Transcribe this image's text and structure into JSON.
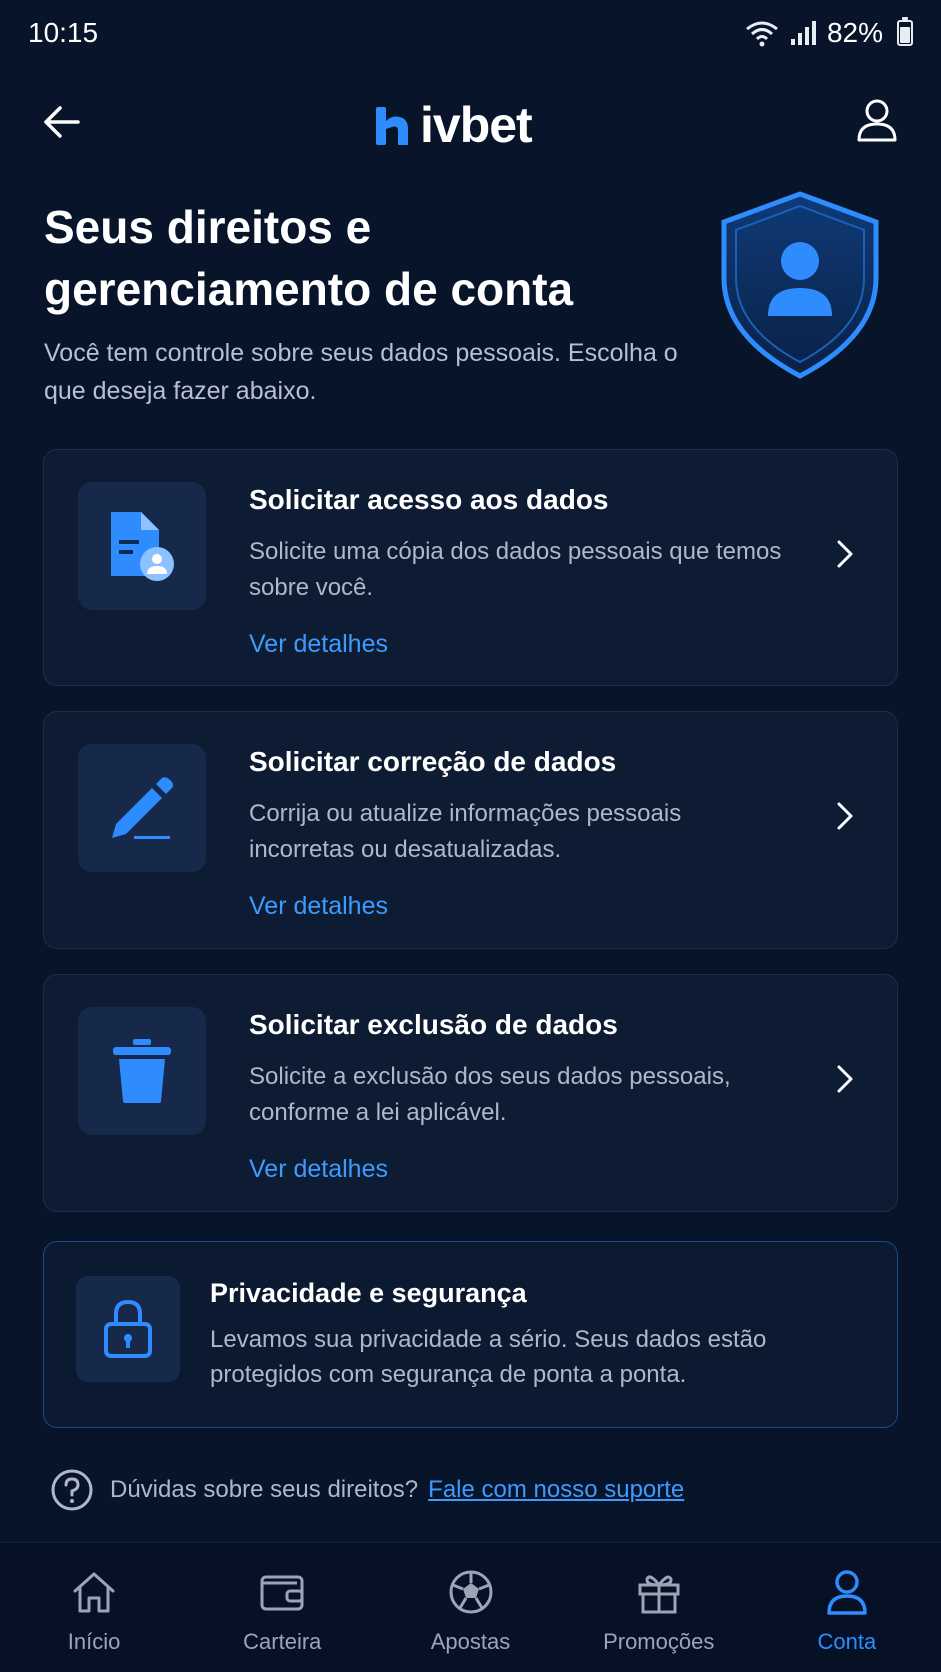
{
  "status_bar": {
    "time": "10:15",
    "battery": "82%",
    "battery_level": 0.82
  },
  "header": {
    "brand": "ivbet"
  },
  "hero": {
    "title": "Seus direitos e gerenciamento de conta",
    "subtitle": "Você tem controle sobre seus dados pessoais. Escolha o que deseja fazer abaixo."
  },
  "cards": [
    {
      "icon": "document-user-icon",
      "title": "Solicitar acesso aos dados",
      "description": "Solicite uma cópia dos dados pessoais que temos sobre você.",
      "link": "Ver detalhes"
    },
    {
      "icon": "pencil-icon",
      "title": "Solicitar correção de dados",
      "description": "Corrija ou atualize informações pessoais incorretas ou desatualizadas.",
      "link": "Ver detalhes"
    },
    {
      "icon": "trash-icon",
      "title": "Solicitar exclusão de dados",
      "description": "Solicite a exclusão dos seus dados pessoais, conforme a lei aplicável.",
      "link": "Ver detalhes"
    }
  ],
  "privacy": {
    "title": "Privacidade e segurança",
    "description": "Levamos sua privacidade a sério. Seus dados estão protegidos com segurança de ponta a ponta."
  },
  "help": {
    "question": "Dúvidas sobre seus direitos?",
    "link": "Fale com nosso suporte"
  },
  "nav": [
    {
      "label": "Início",
      "icon": "home-icon",
      "active": false
    },
    {
      "label": "Carteira",
      "icon": "wallet-icon",
      "active": false
    },
    {
      "label": "Apostas",
      "icon": "soccer-ball-icon",
      "active": false
    },
    {
      "label": "Promoções",
      "icon": "gift-icon",
      "active": false
    },
    {
      "label": "Conta",
      "icon": "user-icon",
      "active": true
    }
  ],
  "colors": {
    "background": "#071429",
    "card": "#0e1c33",
    "accent": "#2f8cff",
    "link": "#3d9bff"
  }
}
